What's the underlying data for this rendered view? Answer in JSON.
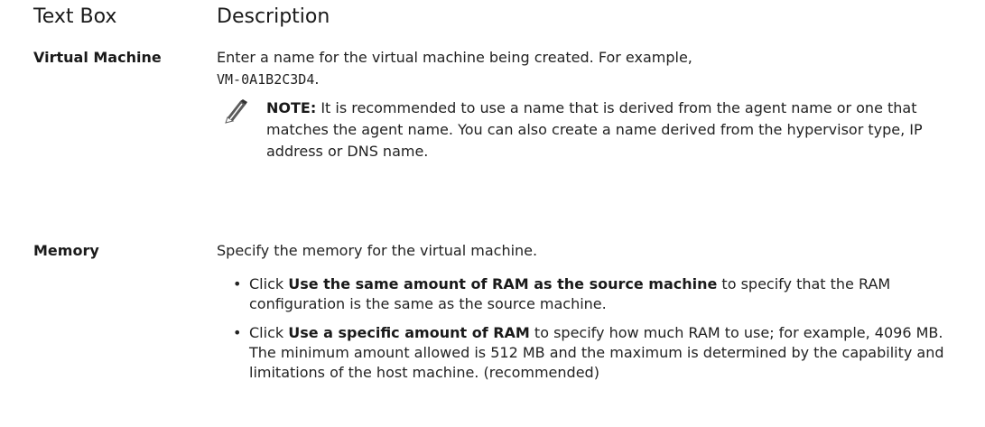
{
  "table": {
    "headers": [
      "Text Box",
      "Description"
    ],
    "rows": [
      {
        "term": "Virtual Machine",
        "description": "Enter a name for the virtual machine being created. For example,",
        "example_code": "VM-0A1B2C3D4",
        "example_suffix": ".",
        "note": {
          "label": "NOTE:",
          "text": "It is recommended to use a name that is derived from the agent name or one that matches the agent name. You can also create a name derived from the hypervisor type, IP address or DNS name."
        }
      },
      {
        "term": "Memory",
        "description": "Specify the memory for the virtual machine.",
        "bullets": [
          {
            "prefix": "Click ",
            "bold": "Use the same amount of RAM as the source machine",
            "suffix": " to specify that the RAM configuration is the same as the source machine."
          },
          {
            "prefix": "Click ",
            "bold": "Use a specific amount of RAM",
            "suffix": " to specify how much RAM to use; for example, 4096 MB. The minimum amount allowed is 512 MB and the maximum is determined by the capability and limitations of the host machine. (recommended)"
          }
        ]
      }
    ]
  },
  "icons": {
    "note": "pencil-note-icon"
  },
  "colors": {
    "text": "#222222",
    "heading": "#1a1a1a"
  }
}
